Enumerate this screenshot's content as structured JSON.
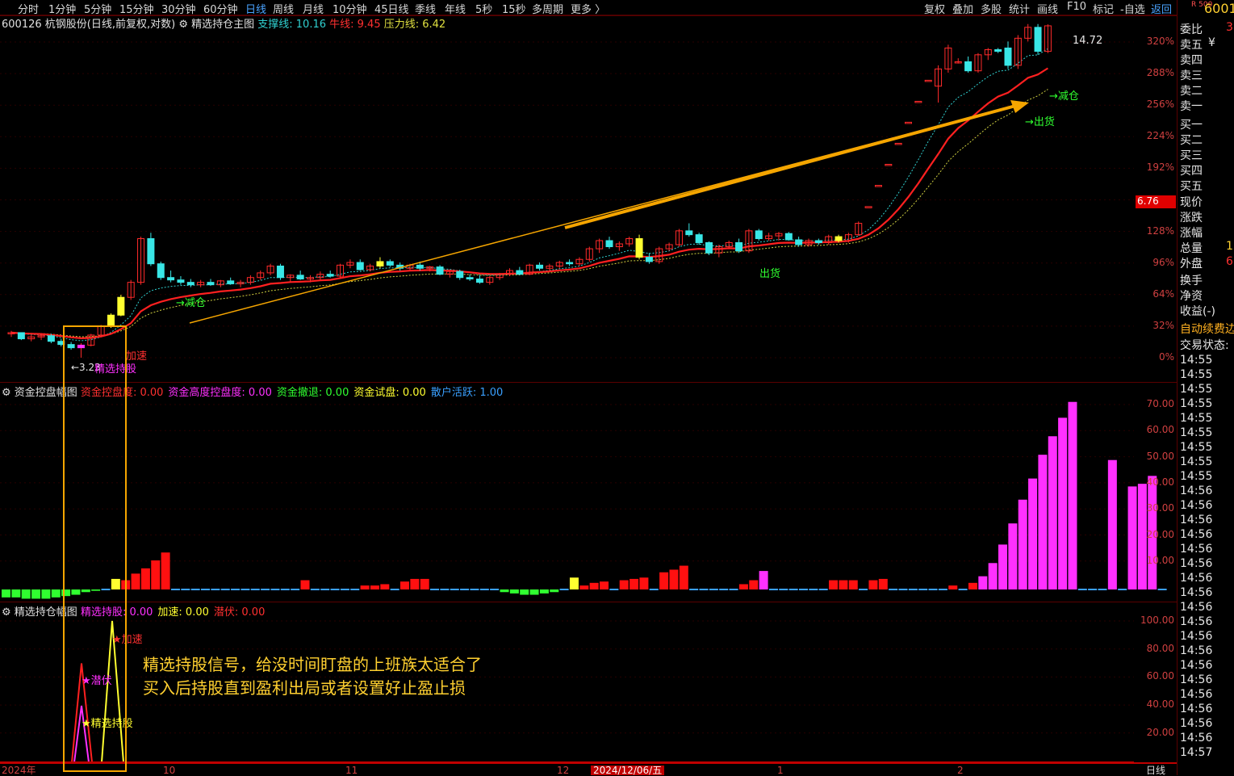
{
  "toolbar": {
    "periods": [
      "分时",
      "1分钟",
      "5分钟",
      "15分钟",
      "30分钟",
      "60分钟",
      "日线",
      "周线",
      "月线",
      "10分钟",
      "45日线",
      "季线",
      "年线",
      "5秒",
      "15秒",
      "多周期",
      "更多 〉"
    ],
    "active_period": "日线",
    "right_buttons": [
      "复权",
      "叠加",
      "多股",
      "统计",
      "画线",
      "F10",
      "标记",
      "-自选",
      "返回"
    ]
  },
  "stock": {
    "title": "600126 杭钢股份(日线,前复权,对数)",
    "indicator_name": "精选持仓主图",
    "support_label": "支撑线: 10.16",
    "bull_label": "牛线: 9.45",
    "pressure_label": "压力线: 6.42",
    "code_short": "6001",
    "index_badge": "R 500"
  },
  "price_axis": {
    "ticks": [
      "320%",
      "288%",
      "256%",
      "224%",
      "192%",
      "160%",
      "128%",
      "96%",
      "64%",
      "32%",
      "0%"
    ],
    "current_price": "6.76"
  },
  "annotations": {
    "high_label": "14.72",
    "low_label": "←3.23",
    "reduce1": "→减仓",
    "reduce2": "→减仓",
    "out1": "出货",
    "out2": "→出货",
    "accel": "加速",
    "hold": "精选持股"
  },
  "panel2": {
    "name": "资金控盘幅图",
    "legend": [
      {
        "text": "资金控盘度: 0.00",
        "color": "#ff3030"
      },
      {
        "text": "资金高度控盘度: 0.00",
        "color": "#ff30ff"
      },
      {
        "text": "资金撤退: 0.00",
        "color": "#30ff30"
      },
      {
        "text": "资金试盘: 0.00",
        "color": "#ffff30"
      },
      {
        "text": "散户活跃: 1.00",
        "color": "#3aa0ff"
      }
    ],
    "ticks": [
      "70.00",
      "60.00",
      "50.00",
      "40.00",
      "30.00",
      "20.00",
      "10.00"
    ]
  },
  "panel3": {
    "name": "精选持仓幅图",
    "legend": [
      {
        "text": "精选持股: 0.00",
        "color": "#ff30ff"
      },
      {
        "text": "加速: 0.00",
        "color": "#ffff30"
      },
      {
        "text": "潜伏: 0.00",
        "color": "#ff3030"
      }
    ],
    "ticks": [
      "100.00",
      "80.00",
      "60.00",
      "40.00",
      "20.00"
    ],
    "mark_accel": "★加速",
    "mark_hide": "★潜伏",
    "mark_hold": "★精选持股",
    "promo_line1": "精选持股信号，给没时间盯盘的上班族太适合了",
    "promo_line2": "买入后持股直到盈利出局或者设置好止盈止损"
  },
  "date_axis": {
    "labels": [
      "2024年",
      "10",
      "11",
      "12",
      "1",
      "2"
    ],
    "highlight": "2024/12/06/五",
    "corner": "日线"
  },
  "side_panel": {
    "labels": [
      "委比",
      "卖五",
      "卖四",
      "卖三",
      "卖二",
      "卖一",
      "买一",
      "买二",
      "买三",
      "买四",
      "买五",
      "现价",
      "涨跌",
      "涨幅",
      "总量",
      "外盘",
      "换手",
      "净资",
      "收益(-)",
      "自动续费边",
      "交易状态:"
    ],
    "sell5_suffix": "¥",
    "wei_bi_value": "3",
    "zong_liang_value": "1",
    "wai_pan_value": "6",
    "times": [
      "14:55",
      "14:55",
      "14:55",
      "14:55",
      "14:55",
      "14:55",
      "14:55",
      "14:55",
      "14:55",
      "14:56",
      "14:56",
      "14:56",
      "14:56",
      "14:56",
      "14:56",
      "14:56",
      "14:56",
      "14:56",
      "14:56",
      "14:56",
      "14:56",
      "14:56",
      "14:56",
      "14:56",
      "14:56",
      "14:56",
      "14:56",
      "14:57"
    ]
  },
  "chart_data": {
    "type": "candlestick",
    "candles": [
      [
        3.6,
        3.65,
        3.55,
        3.62
      ],
      [
        3.62,
        3.62,
        3.5,
        3.52
      ],
      [
        3.52,
        3.58,
        3.48,
        3.55
      ],
      [
        3.55,
        3.6,
        3.5,
        3.57
      ],
      [
        3.57,
        3.6,
        3.45,
        3.48
      ],
      [
        3.48,
        3.52,
        3.4,
        3.43
      ],
      [
        3.43,
        3.47,
        3.35,
        3.38
      ],
      [
        3.38,
        3.45,
        3.23,
        3.42
      ],
      [
        3.42,
        3.6,
        3.4,
        3.58
      ],
      [
        3.58,
        3.75,
        3.55,
        3.72
      ],
      [
        3.72,
        3.95,
        3.7,
        3.92
      ],
      [
        3.92,
        4.3,
        3.9,
        4.25
      ],
      [
        4.25,
        4.6,
        4.2,
        4.55
      ],
      [
        4.55,
        5.6,
        4.5,
        5.55
      ],
      [
        5.55,
        5.7,
        4.9,
        4.95
      ],
      [
        4.95,
        5.0,
        4.6,
        4.65
      ],
      [
        4.65,
        4.8,
        4.55,
        4.6
      ],
      [
        4.6,
        4.68,
        4.5,
        4.55
      ],
      [
        4.55,
        4.62,
        4.45,
        4.5
      ],
      [
        4.5,
        4.6,
        4.45,
        4.55
      ],
      [
        4.55,
        4.62,
        4.48,
        4.5
      ],
      [
        4.5,
        4.6,
        4.45,
        4.58
      ],
      [
        4.58,
        4.65,
        4.5,
        4.52
      ],
      [
        4.52,
        4.6,
        4.45,
        4.55
      ],
      [
        4.55,
        4.7,
        4.5,
        4.65
      ],
      [
        4.65,
        4.8,
        4.6,
        4.75
      ],
      [
        4.75,
        4.95,
        4.7,
        4.9
      ],
      [
        4.9,
        4.95,
        4.6,
        4.65
      ],
      [
        4.65,
        4.72,
        4.55,
        4.7
      ],
      [
        4.7,
        4.8,
        4.6,
        4.62
      ],
      [
        4.62,
        4.7,
        4.55,
        4.65
      ],
      [
        4.65,
        4.78,
        4.6,
        4.72
      ],
      [
        4.72,
        4.8,
        4.65,
        4.68
      ],
      [
        4.68,
        4.95,
        4.65,
        4.92
      ],
      [
        4.92,
        5.05,
        4.85,
        4.98
      ],
      [
        4.98,
        5.05,
        4.8,
        4.82
      ],
      [
        4.82,
        4.95,
        4.78,
        4.9
      ],
      [
        4.9,
        5.1,
        4.85,
        5.0
      ],
      [
        5.0,
        5.05,
        4.88,
        4.92
      ],
      [
        4.92,
        4.98,
        4.8,
        4.85
      ],
      [
        4.85,
        4.95,
        4.8,
        4.92
      ],
      [
        4.92,
        5.0,
        4.8,
        4.85
      ],
      [
        4.85,
        4.9,
        4.78,
        4.88
      ],
      [
        4.88,
        4.92,
        4.7,
        4.72
      ],
      [
        4.72,
        4.8,
        4.65,
        4.78
      ],
      [
        4.78,
        4.82,
        4.6,
        4.65
      ],
      [
        4.65,
        4.72,
        4.58,
        4.62
      ],
      [
        4.62,
        4.7,
        4.52,
        4.55
      ],
      [
        4.55,
        4.68,
        4.5,
        4.65
      ],
      [
        4.65,
        4.75,
        4.6,
        4.72
      ],
      [
        4.72,
        4.85,
        4.68,
        4.8
      ],
      [
        4.8,
        4.88,
        4.7,
        4.72
      ],
      [
        4.72,
        4.95,
        4.7,
        4.92
      ],
      [
        4.92,
        4.98,
        4.8,
        4.85
      ],
      [
        4.85,
        4.95,
        4.8,
        4.9
      ],
      [
        4.9,
        5.02,
        4.85,
        4.98
      ],
      [
        4.98,
        5.05,
        4.9,
        4.95
      ],
      [
        4.95,
        5.1,
        4.9,
        5.05
      ],
      [
        5.05,
        5.35,
        5.0,
        5.3
      ],
      [
        5.3,
        5.55,
        5.2,
        5.5
      ],
      [
        5.5,
        5.6,
        5.3,
        5.35
      ],
      [
        5.35,
        5.48,
        5.25,
        5.42
      ],
      [
        5.42,
        5.6,
        5.35,
        5.55
      ],
      [
        5.55,
        5.65,
        5.05,
        5.1
      ],
      [
        5.1,
        5.2,
        4.95,
        5.0
      ],
      [
        5.0,
        5.35,
        4.95,
        5.3
      ],
      [
        5.3,
        5.45,
        5.25,
        5.4
      ],
      [
        5.4,
        5.8,
        5.35,
        5.75
      ],
      [
        5.75,
        5.95,
        5.6,
        5.65
      ],
      [
        5.65,
        5.7,
        5.4,
        5.45
      ],
      [
        5.45,
        5.48,
        5.15,
        5.2
      ],
      [
        5.2,
        5.4,
        5.1,
        5.35
      ],
      [
        5.35,
        5.5,
        5.3,
        5.45
      ],
      [
        5.45,
        5.55,
        5.2,
        5.25
      ],
      [
        5.25,
        5.8,
        5.2,
        5.75
      ],
      [
        5.75,
        5.8,
        5.5,
        5.55
      ],
      [
        5.55,
        5.7,
        5.5,
        5.62
      ],
      [
        5.62,
        5.72,
        5.5,
        5.68
      ],
      [
        5.68,
        5.72,
        5.5,
        5.52
      ],
      [
        5.52,
        5.6,
        5.35,
        5.4
      ],
      [
        5.4,
        5.55,
        5.35,
        5.5
      ],
      [
        5.5,
        5.55,
        5.4,
        5.45
      ],
      [
        5.45,
        5.65,
        5.4,
        5.6
      ],
      [
        5.6,
        5.65,
        5.45,
        5.5
      ],
      [
        5.5,
        5.7,
        5.45,
        5.65
      ],
      [
        5.65,
        6.0,
        5.62,
        5.95
      ],
      [
        6.42,
        6.42,
        6.42,
        6.42
      ],
      [
        7.07,
        7.07,
        7.07,
        7.07
      ],
      [
        7.78,
        7.78,
        7.78,
        7.78
      ],
      [
        8.56,
        8.56,
        8.56,
        8.56
      ],
      [
        9.42,
        9.42,
        9.42,
        9.42
      ],
      [
        10.36,
        10.36,
        10.36,
        10.36
      ],
      [
        11.4,
        11.4,
        11.4,
        11.4
      ],
      [
        11.1,
        12.2,
        10.3,
        12.0
      ],
      [
        12.0,
        13.4,
        11.8,
        13.2
      ],
      [
        12.35,
        12.6,
        12.3,
        12.4
      ],
      [
        12.4,
        12.7,
        11.8,
        11.9
      ],
      [
        11.9,
        12.9,
        11.8,
        12.8
      ],
      [
        12.8,
        13.2,
        12.5,
        13.1
      ],
      [
        13.1,
        13.2,
        12.9,
        13.0
      ],
      [
        13.2,
        13.6,
        12.0,
        12.2
      ],
      [
        12.2,
        14.0,
        12.0,
        13.8
      ],
      [
        13.8,
        14.72,
        13.6,
        14.5
      ],
      [
        14.5,
        14.72,
        12.8,
        13.0
      ],
      [
        13.0,
        14.7,
        12.9,
        14.6
      ]
    ],
    "ma_lines": [
      {
        "name": "牛线",
        "color": "#ff2020"
      },
      {
        "name": "支撑线",
        "color": "#30d0d0"
      },
      {
        "name": "压力线",
        "color": "#d0d040"
      }
    ],
    "funds_bars": [
      {
        "v": -3,
        "c": "g"
      },
      {
        "v": -3,
        "c": "g"
      },
      {
        "v": -3.5,
        "c": "g"
      },
      {
        "v": -3.5,
        "c": "g"
      },
      {
        "v": -3.5,
        "c": "g"
      },
      {
        "v": -3,
        "c": "g"
      },
      {
        "v": -2.5,
        "c": "g"
      },
      {
        "v": -2,
        "c": "g"
      },
      {
        "v": -1,
        "c": "g"
      },
      {
        "v": -0.5,
        "c": "g"
      },
      {
        "v": 0.5,
        "c": "b"
      },
      {
        "v": 4,
        "c": "y"
      },
      {
        "v": 3.5,
        "c": "r"
      },
      {
        "v": 6,
        "c": "r"
      },
      {
        "v": 8,
        "c": "r"
      },
      {
        "v": 11,
        "c": "r"
      },
      {
        "v": 14,
        "c": "r"
      },
      {
        "v": 0.5,
        "c": "b"
      },
      {
        "v": 0.5,
        "c": "b"
      },
      {
        "v": 0.5,
        "c": "b"
      },
      {
        "v": 0.5,
        "c": "b"
      },
      {
        "v": 0.5,
        "c": "b"
      },
      {
        "v": 0.5,
        "c": "b"
      },
      {
        "v": 0.5,
        "c": "b"
      },
      {
        "v": 0.5,
        "c": "b"
      },
      {
        "v": 0.5,
        "c": "b"
      },
      {
        "v": 0.5,
        "c": "b"
      },
      {
        "v": 0.5,
        "c": "b"
      },
      {
        "v": 0.5,
        "c": "b"
      },
      {
        "v": 0.5,
        "c": "b"
      },
      {
        "v": 3.5,
        "c": "r"
      },
      {
        "v": 0.5,
        "c": "b"
      },
      {
        "v": 0.5,
        "c": "b"
      },
      {
        "v": 0.5,
        "c": "b"
      },
      {
        "v": 0.5,
        "c": "b"
      },
      {
        "v": 0.5,
        "c": "b"
      },
      {
        "v": 1.5,
        "c": "r"
      },
      {
        "v": 1.5,
        "c": "r"
      },
      {
        "v": 2,
        "c": "r"
      },
      {
        "v": 0.5,
        "c": "b"
      },
      {
        "v": 3,
        "c": "r"
      },
      {
        "v": 4,
        "c": "r"
      },
      {
        "v": 4,
        "c": "r"
      },
      {
        "v": 0.5,
        "c": "b"
      },
      {
        "v": 0.5,
        "c": "b"
      },
      {
        "v": 0.5,
        "c": "b"
      },
      {
        "v": 0.5,
        "c": "b"
      },
      {
        "v": 0.5,
        "c": "b"
      },
      {
        "v": 0.5,
        "c": "b"
      },
      {
        "v": 0.5,
        "c": "b"
      },
      {
        "v": -1,
        "c": "g"
      },
      {
        "v": -1.5,
        "c": "g"
      },
      {
        "v": -2,
        "c": "g"
      },
      {
        "v": -2,
        "c": "g"
      },
      {
        "v": -1.5,
        "c": "g"
      },
      {
        "v": -1,
        "c": "g"
      },
      {
        "v": 0.5,
        "c": "b"
      },
      {
        "v": 4.5,
        "c": "y"
      },
      {
        "v": 1.5,
        "c": "r"
      },
      {
        "v": 2.5,
        "c": "r"
      },
      {
        "v": 3,
        "c": "r"
      },
      {
        "v": 0.5,
        "c": "b"
      },
      {
        "v": 3.5,
        "c": "r"
      },
      {
        "v": 4,
        "c": "r"
      },
      {
        "v": 4.5,
        "c": "r"
      },
      {
        "v": 0.5,
        "c": "b"
      },
      {
        "v": 6.5,
        "c": "r"
      },
      {
        "v": 7.5,
        "c": "r"
      },
      {
        "v": 9,
        "c": "r"
      },
      {
        "v": 0.5,
        "c": "b"
      },
      {
        "v": 0.5,
        "c": "b"
      },
      {
        "v": 0.5,
        "c": "b"
      },
      {
        "v": 0.5,
        "c": "b"
      },
      {
        "v": 0.5,
        "c": "b"
      },
      {
        "v": 2,
        "c": "r"
      },
      {
        "v": 3.5,
        "c": "r"
      },
      {
        "v": 7,
        "c": "m"
      },
      {
        "v": 0.5,
        "c": "b"
      },
      {
        "v": 0.5,
        "c": "b"
      },
      {
        "v": 0.5,
        "c": "b"
      },
      {
        "v": 0.5,
        "c": "b"
      },
      {
        "v": 0.5,
        "c": "b"
      },
      {
        "v": 0.5,
        "c": "b"
      },
      {
        "v": 3.5,
        "c": "r"
      },
      {
        "v": 3.5,
        "c": "r"
      },
      {
        "v": 3.5,
        "c": "r"
      },
      {
        "v": 0.5,
        "c": "b"
      },
      {
        "v": 3.5,
        "c": "r"
      },
      {
        "v": 4,
        "c": "r"
      },
      {
        "v": 0.5,
        "c": "b"
      },
      {
        "v": 0.5,
        "c": "b"
      },
      {
        "v": 0.5,
        "c": "b"
      },
      {
        "v": 0.5,
        "c": "b"
      },
      {
        "v": 0.5,
        "c": "b"
      },
      {
        "v": 0.5,
        "c": "b"
      },
      {
        "v": 1.5,
        "c": "r"
      },
      {
        "v": 0.5,
        "c": "b"
      },
      {
        "v": 2.5,
        "c": "r"
      },
      {
        "v": 5,
        "c": "m"
      },
      {
        "v": 10,
        "c": "m"
      },
      {
        "v": 17,
        "c": "m"
      },
      {
        "v": 25,
        "c": "m"
      },
      {
        "v": 34,
        "c": "m"
      },
      {
        "v": 42,
        "c": "m"
      },
      {
        "v": 51,
        "c": "m"
      },
      {
        "v": 58,
        "c": "m"
      },
      {
        "v": 65,
        "c": "m"
      },
      {
        "v": 71,
        "c": "m"
      },
      {
        "v": 0.5,
        "c": "b"
      },
      {
        "v": 0.5,
        "c": "b"
      },
      {
        "v": 0.5,
        "c": "b"
      },
      {
        "v": 49,
        "c": "m"
      },
      {
        "v": 0.5,
        "c": "b"
      },
      {
        "v": 39,
        "c": "m"
      },
      {
        "v": 40,
        "c": "m"
      },
      {
        "v": 43,
        "c": "m"
      },
      {
        "v": 0.5,
        "c": "b"
      }
    ],
    "signal_triangles": [
      {
        "color": "#ff2020",
        "peak": 70
      },
      {
        "color": "#ff30ff",
        "peak": 40
      },
      {
        "color": "#ffff30",
        "peak": 100
      }
    ]
  },
  "colors": {
    "up": "#ff2a2a",
    "down": "#39e6e6",
    "highlight_box": "#f5a500"
  }
}
